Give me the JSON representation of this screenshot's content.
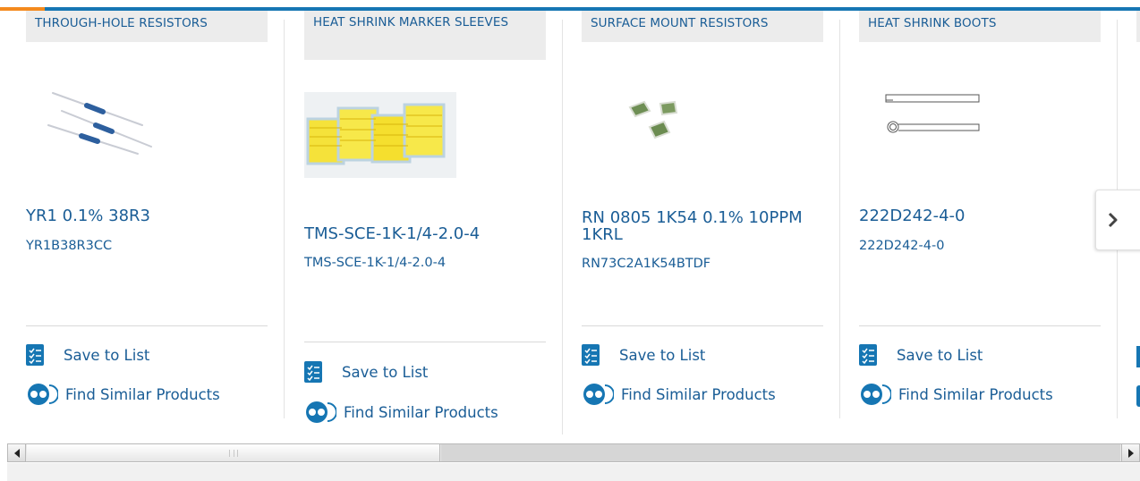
{
  "cards": [
    {
      "category": "THROUGH-HOLE RESISTORS",
      "product_name": "YR1 0.1% 38R3",
      "part_number": "YR1B38R3CC",
      "image": "axial-resistors-image",
      "save_label": "Save to List",
      "find_label": "Find Similar Products"
    },
    {
      "category": "HEAT SHRINK MARKER SLEEVES",
      "product_name": "TMS-SCE-1K-1/4-2.0-4",
      "part_number": "TMS-SCE-1K-1/4-2.0-4",
      "image": "marker-sleeves-image",
      "save_label": "Save to List",
      "find_label": "Find Similar Products"
    },
    {
      "category": "SURFACE MOUNT RESISTORS",
      "product_name": "RN 0805 1K54 0.1% 10PPM 1KRL",
      "part_number": "RN73C2A1K54BTDF",
      "image": "smd-resistors-image",
      "save_label": "Save to List",
      "find_label": "Find Similar Products"
    },
    {
      "category": "HEAT SHRINK BOOTS",
      "product_name": "222D242-4-0",
      "part_number": "222D242-4-0",
      "image": "heat-shrink-boot-drawing",
      "save_label": "Save to List",
      "find_label": "Find Similar Products"
    }
  ],
  "carousel": {
    "next_icon": "chevron-right-icon"
  },
  "colors": {
    "accent_blue": "#1676b3",
    "accent_orange": "#f48a1d",
    "link_blue": "#1a5d96",
    "category_bg": "#ececec"
  }
}
